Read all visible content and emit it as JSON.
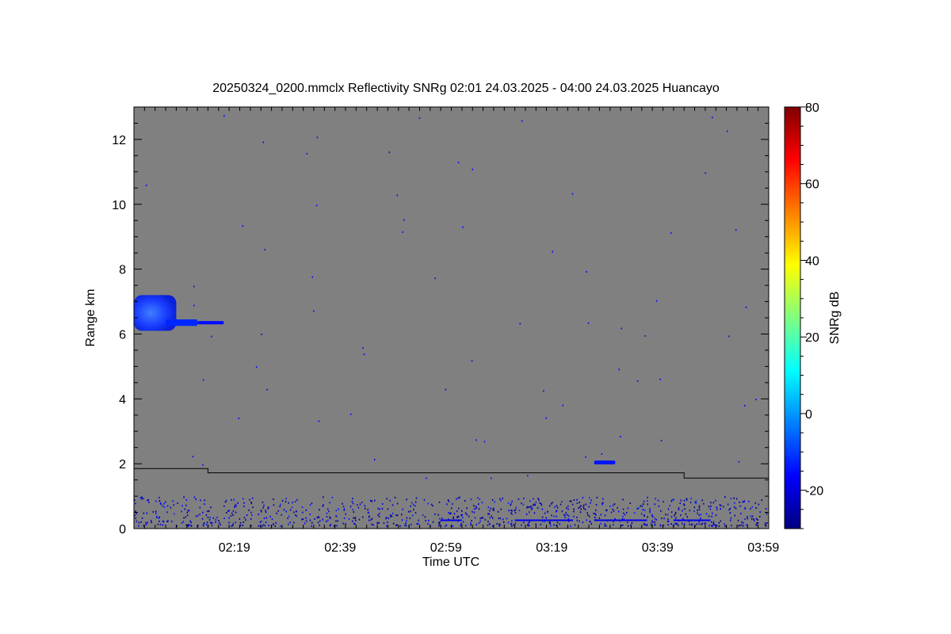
{
  "chart_data": {
    "type": "heatmap",
    "title": "20250324_0200.mmclx Reflectivity SNRg   02:01 24.03.2025 - 04:00 24.03.2025 Huancayo",
    "xlabel": "Time UTC",
    "ylabel": "Range km",
    "x_tick_labels": [
      "02:19",
      "02:39",
      "02:59",
      "03:19",
      "03:39",
      "03:59"
    ],
    "x_tick_values_min": [
      139,
      159,
      179,
      199,
      219,
      239
    ],
    "xlim_min": [
      120,
      240
    ],
    "y_ticks": [
      0,
      2,
      4,
      6,
      8,
      10,
      12
    ],
    "y_tick_labels": [
      "0",
      "2",
      "4",
      "6",
      "8",
      "10",
      "12"
    ],
    "ylim": [
      0,
      13
    ],
    "background_color": "#808080",
    "colorbar": {
      "label": "SNRg dB",
      "range": [
        -30,
        80
      ],
      "ticks": [
        -20,
        0,
        20,
        40,
        60,
        80
      ],
      "tick_labels": [
        "-20",
        "0",
        "20",
        "40",
        "60",
        "80"
      ],
      "colormap": "jet"
    },
    "threshold_line": {
      "color": "#000000",
      "segments": [
        {
          "x_min": [
            120,
            134
          ],
          "range_km": 1.85
        },
        {
          "x_min": [
            134,
            224
          ],
          "range_km": 1.72
        },
        {
          "x_min": [
            224,
            240
          ],
          "range_km": 1.56
        }
      ]
    },
    "echo_regions": [
      {
        "x_min": [
          120,
          128
        ],
        "range_km": [
          6.1,
          7.2
        ],
        "snr_db": -8
      },
      {
        "x_min": [
          126,
          132
        ],
        "range_km": [
          6.25,
          6.45
        ],
        "snr_db": -12
      },
      {
        "x_min": [
          132,
          137
        ],
        "range_km": [
          6.3,
          6.4
        ],
        "snr_db": -15
      },
      {
        "x_min": [
          207,
          211
        ],
        "range_km": [
          1.98,
          2.1
        ],
        "snr_db": -14
      },
      {
        "x_min": [
          120,
          240
        ],
        "range_km": [
          0.1,
          1.0
        ],
        "snr_db": -18,
        "pattern": "sparse"
      }
    ]
  }
}
